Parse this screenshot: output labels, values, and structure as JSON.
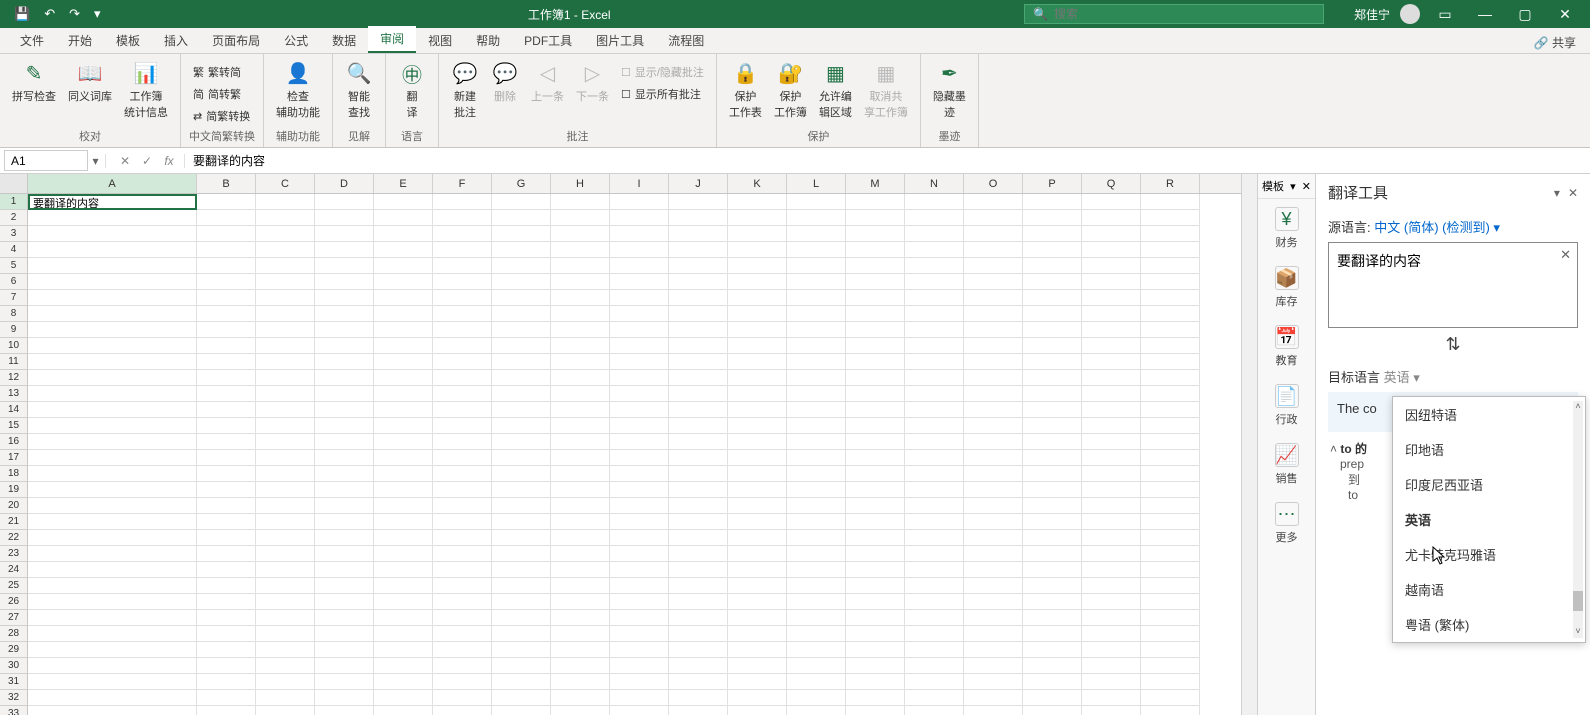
{
  "titlebar": {
    "doc_title": "工作簿1 - Excel",
    "search_placeholder": "搜索",
    "user_name": "郑佳宁"
  },
  "tabs": [
    "文件",
    "开始",
    "模板",
    "插入",
    "页面布局",
    "公式",
    "数据",
    "审阅",
    "视图",
    "帮助",
    "PDF工具",
    "图片工具",
    "流程图"
  ],
  "tabs_active": "审阅",
  "share_label": "共享",
  "ribbon": {
    "g1": {
      "b1": "拼写检查",
      "b2": "同义词库",
      "b3": "工作簿\n统计信息",
      "label": "校对"
    },
    "g2": {
      "b1": "繁转简",
      "b2": "简转繁",
      "b3": "简繁转换",
      "label": "中文简繁转换"
    },
    "g3": {
      "b1": "检查\n辅助功能",
      "label": "辅助功能"
    },
    "g4": {
      "b1": "智能\n查找",
      "label": "见解"
    },
    "g5": {
      "b1": "翻\n译",
      "label": "语言"
    },
    "g6": {
      "b1": "新建\n批注",
      "b2": "删除",
      "b3": "上一条",
      "b4": "下一条",
      "b5": "显示/隐藏批注",
      "b6": "显示所有批注",
      "label": "批注"
    },
    "g7": {
      "b1": "保护\n工作表",
      "b2": "保护\n工作簿",
      "b3": "允许编\n辑区域",
      "b4": "取消共\n享工作簿",
      "label": "保护"
    },
    "g8": {
      "b1": "隐藏墨\n迹",
      "label": "墨迹"
    }
  },
  "name_box": "A1",
  "formula_value": "要翻译的内容",
  "columns": [
    "A",
    "B",
    "C",
    "D",
    "E",
    "F",
    "G",
    "H",
    "I",
    "J",
    "K",
    "L",
    "M",
    "N",
    "O",
    "P",
    "Q",
    "R"
  ],
  "row_count": 33,
  "cell_a1": "要翻译的内容",
  "template_panel": {
    "header": "模板",
    "items": [
      {
        "label": "财务"
      },
      {
        "label": "库存"
      },
      {
        "label": "教育"
      },
      {
        "label": "行政"
      },
      {
        "label": "销售"
      },
      {
        "label": "更多"
      }
    ]
  },
  "translate": {
    "title": "翻译工具",
    "source_label": "源语言:",
    "source_lang": "中文 (简体) (检测到)",
    "source_text": "要翻译的内容",
    "target_label": "目标语言",
    "target_lang": "英语",
    "result_text": "The co",
    "swap_glyph": "⇅",
    "dict_head": "to 的",
    "dict_pos": "prep",
    "dict_line1": "到",
    "dict_line2": "to",
    "dropdown_options": [
      "因纽特语",
      "印地语",
      "印度尼西亚语",
      "英语",
      "尤卡特克玛雅语",
      "越南语",
      "粤语 (繁体)"
    ],
    "dropdown_highlighted": "英语"
  }
}
